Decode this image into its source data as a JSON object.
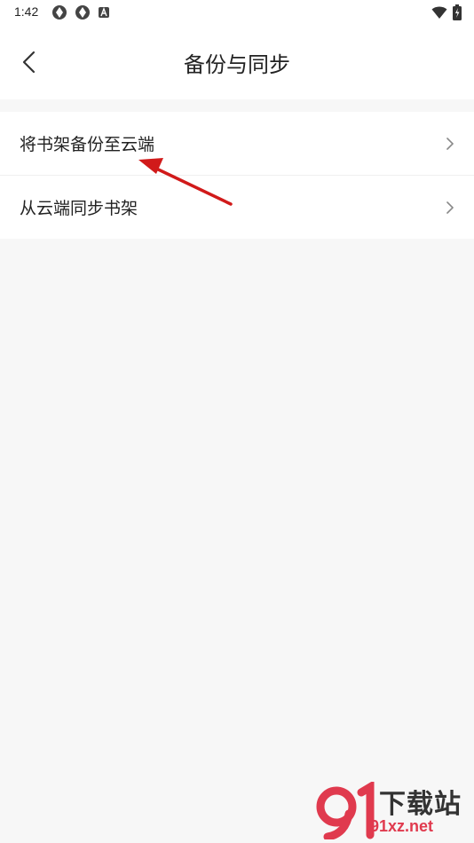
{
  "status_bar": {
    "time": "1:42"
  },
  "header": {
    "title": "备份与同步"
  },
  "menu": {
    "items": [
      {
        "label": "将书架备份至云端",
        "icon": "chevron-right-icon"
      },
      {
        "label": "从云端同步书架",
        "icon": "chevron-right-icon"
      }
    ]
  },
  "annotation": {
    "arrow_color": "#d11a1a"
  },
  "watermark": {
    "brand": "下载站",
    "url": "91xz.net",
    "accent": "#e03a4e"
  }
}
